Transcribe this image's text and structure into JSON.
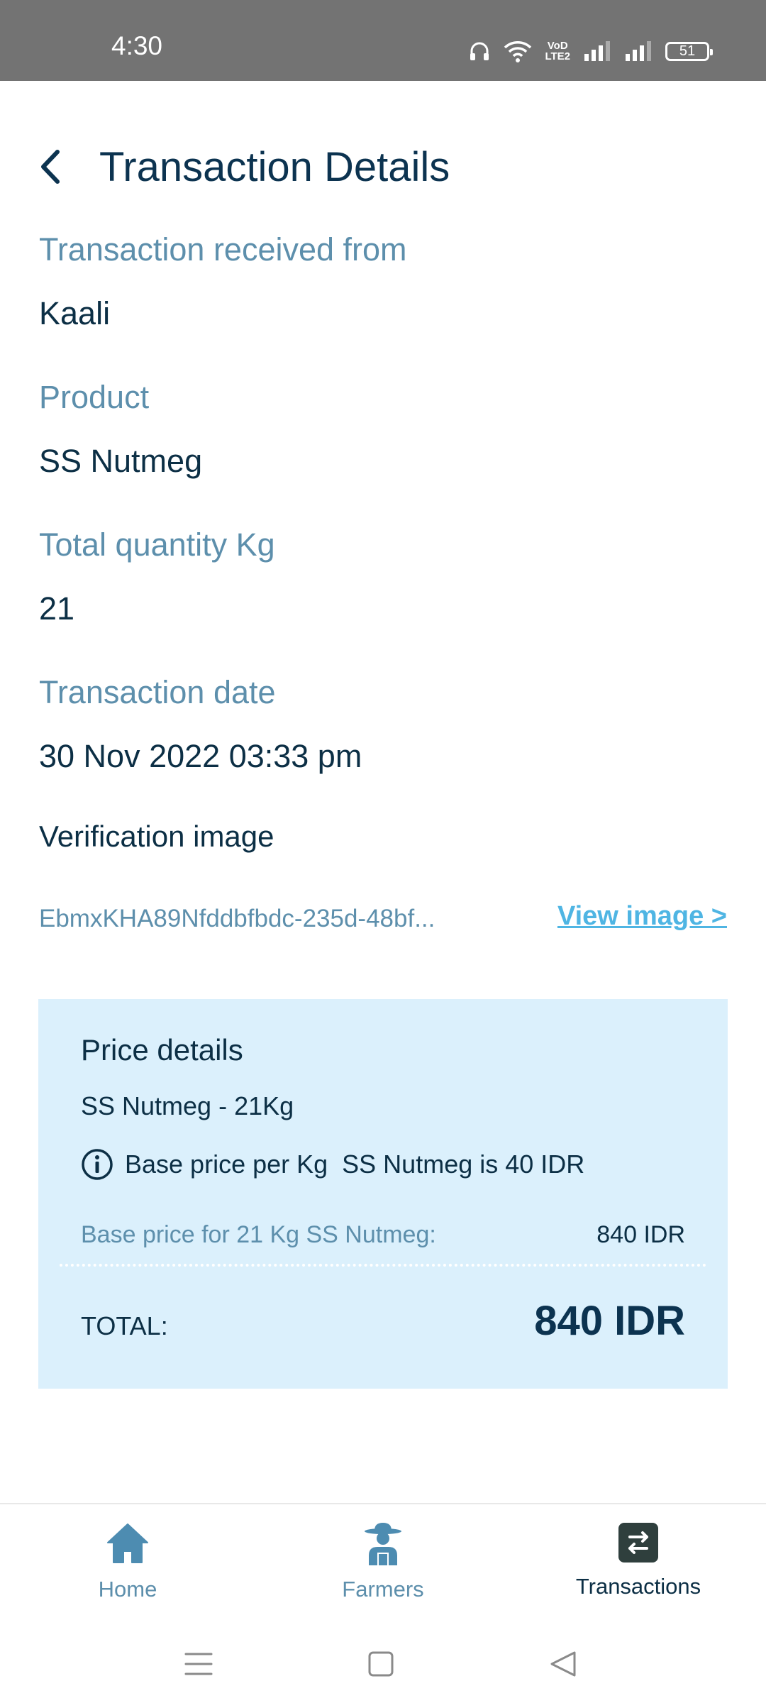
{
  "status_bar": {
    "time": "4:30",
    "volte_top": "VoD",
    "volte_bottom": "LTE2",
    "battery": "51",
    "icons": [
      "headphones-icon",
      "wifi-icon",
      "volte-icon",
      "signal-icon",
      "signal-icon",
      "battery-icon"
    ]
  },
  "header": {
    "title": "Transaction Details",
    "back_icon": "chevron-left-icon"
  },
  "fields": [
    {
      "label": "Transaction received from",
      "value": "Kaali"
    },
    {
      "label": "Product",
      "value": "SS Nutmeg"
    },
    {
      "label": "Total quantity Kg",
      "value": "21"
    },
    {
      "label": "Transaction date",
      "value": "30 Nov 2022 03:33 pm"
    }
  ],
  "verification": {
    "label": "Verification image",
    "image_id": "EbmxKHA89Nfddbfbdc-235d-48bf...",
    "view_link": "View image >"
  },
  "price_details": {
    "title": "Price details",
    "summary": "SS Nutmeg - 21Kg",
    "info": "Base price per Kg  SS Nutmeg is 40 IDR",
    "base_label": "Base price for 21 Kg SS Nutmeg:",
    "base_amount": "840 IDR",
    "total_label": "TOTAL:",
    "total_amount": "840 IDR"
  },
  "bottom_nav": {
    "items": [
      {
        "label": "Home",
        "icon": "home-icon"
      },
      {
        "label": "Farmers",
        "icon": "farmer-icon"
      },
      {
        "label": "Transactions",
        "icon": "transactions-icon",
        "active": true
      }
    ]
  },
  "colors": {
    "status_bar_bg": "#737373",
    "label": "#5d8fac",
    "text": "#0c2f45",
    "link": "#4fb5e3",
    "card_bg": "#dbf0fc"
  }
}
